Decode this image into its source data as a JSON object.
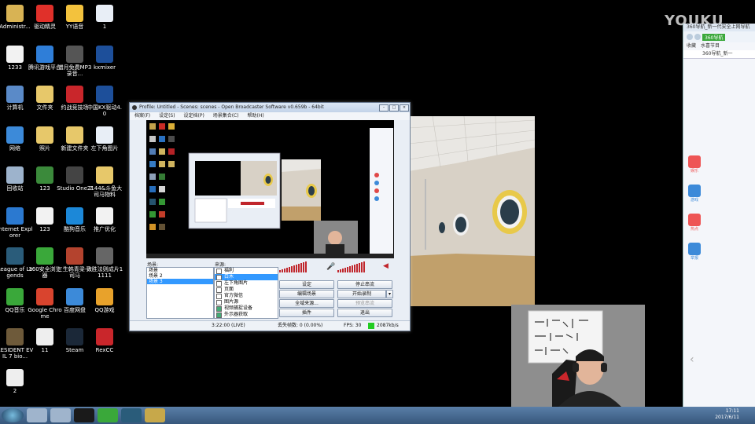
{
  "watermark": "YOUKU",
  "desktop_icons": [
    {
      "label": "Administr...",
      "color": "#d8b354"
    },
    {
      "label": "驱动精灵",
      "color": "#e0302a"
    },
    {
      "label": "YY语音",
      "color": "#f3c23d"
    },
    {
      "label": "1",
      "color": "#e8eef6"
    },
    {
      "label": "1233",
      "color": "#f2f2f2"
    },
    {
      "label": "腾讯游戏平台",
      "color": "#2f7ed8"
    },
    {
      "label": "错月免费MP3录音...",
      "color": "#555555"
    },
    {
      "label": "kxmixer",
      "color": "#1d4f9a"
    },
    {
      "label": "计算机",
      "color": "#5a8ac8"
    },
    {
      "label": "文件夹",
      "color": "#e7c86a"
    },
    {
      "label": "约战竞技场",
      "color": "#c9262b"
    },
    {
      "label": "中国KX驱动4.0",
      "color": "#1d4f9a"
    },
    {
      "label": "网络",
      "color": "#3c8ad9"
    },
    {
      "label": "照片",
      "color": "#e7c86a"
    },
    {
      "label": "新建文件夹",
      "color": "#e7c86a"
    },
    {
      "label": "左下角图片",
      "color": "#e8eef6"
    },
    {
      "label": "回收站",
      "color": "#9db3cc"
    },
    {
      "label": "123",
      "color": "#3b8a3b"
    },
    {
      "label": "Studio One 2",
      "color": "#444444"
    },
    {
      "label": "2144&斗鱼大司马物料",
      "color": "#e7c86a"
    },
    {
      "label": "Internet Explorer",
      "color": "#2b79d0"
    },
    {
      "label": "123",
      "color": "#f2f2f2"
    },
    {
      "label": "酷狗音乐",
      "color": "#1c88d8"
    },
    {
      "label": "推广优化",
      "color": "#f2f2f2"
    },
    {
      "label": "League of Legends",
      "color": "#2a5c7a"
    },
    {
      "label": "360安全浏览器",
      "color": "#3aa83a"
    },
    {
      "label": "三生韩青梁-大司马",
      "color": "#b4432e"
    },
    {
      "label": "致胜法则成片11111",
      "color": "#666666"
    },
    {
      "label": "QQ音乐",
      "color": "#3aa83a"
    },
    {
      "label": "Google Chrome",
      "color": "#d9442e"
    },
    {
      "label": "百度网盘",
      "color": "#3c8ad9"
    },
    {
      "label": "QQ游戏",
      "color": "#e8a22b"
    },
    {
      "label": "RESIDENT EVIL 7 bio...",
      "color": "#6e5a3a"
    },
    {
      "label": "11",
      "color": "#eeeeee"
    },
    {
      "label": "Steam",
      "color": "#1b2838"
    },
    {
      "label": "RexCC",
      "color": "#c9262b"
    },
    {
      "label": "2",
      "color": "#eeeeee"
    }
  ],
  "obs": {
    "title": "Profile: Untitled - Scenes: scenes - Open Broadcaster Software v0.659b - 64bit",
    "menu": [
      "档案(F)",
      "设定(S)",
      "设定档(P)",
      "场景集合(C)",
      "帮助(H)"
    ],
    "scenes_label": "场景:",
    "scenes": [
      "场景",
      "场景 2",
      "场景 3"
    ],
    "sources_label": "来源:",
    "sources": [
      {
        "label": "福利",
        "checked": false
      },
      {
        "label": "白木",
        "checked": false
      },
      {
        "label": "左下角图片",
        "checked": false
      },
      {
        "label": "页面",
        "checked": false
      },
      {
        "label": "官方微信",
        "checked": false
      },
      {
        "label": "图片源",
        "checked": false
      },
      {
        "label": "视频捕捉设备",
        "checked": true
      },
      {
        "label": "外示器获取",
        "checked": true
      }
    ],
    "buttons": {
      "settings": "设定",
      "stop_stream": "停止串流",
      "edit_scene": "编辑场景",
      "start_recording": "开始录制",
      "global_sources": "全域来源...",
      "preview_stream": "预览串流",
      "plugins": "插件",
      "exit": "退出"
    },
    "status": {
      "time": "3:22:00 (LIVE)",
      "dropped": "丢失帧数: 0 (0.00%)",
      "fps": "FPS: 30",
      "bitrate": "2087kb/s"
    }
  },
  "browser": {
    "tab": "360导航_新一代安全上网导航",
    "nav_label": "360导航",
    "bookmarks": [
      "收藏",
      "水喜节目"
    ],
    "page_tab": "360导航_新一",
    "side_items": [
      "娱乐",
      "游戏",
      "热点",
      "举报"
    ]
  },
  "taskbar": {
    "time": "17:11",
    "date": "2017/6/11"
  },
  "colors": {
    "obs_accent": "#3399ff",
    "meter_red": "#c0262c",
    "live_green": "#22cc22"
  }
}
